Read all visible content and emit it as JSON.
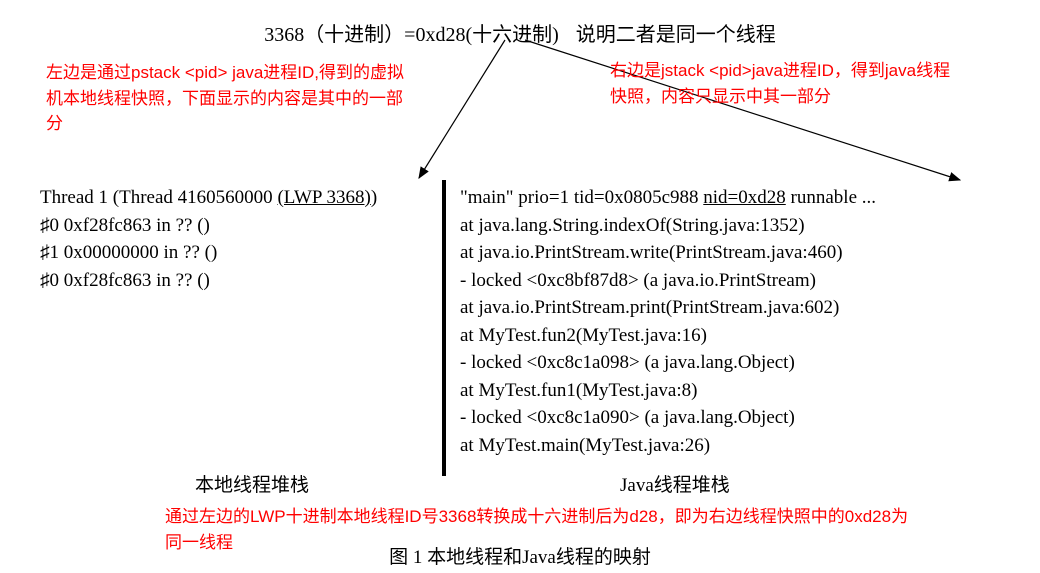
{
  "header": {
    "left": "3368（十进制）=0xd28(十六进制)",
    "right": "说明二者是同一个线程"
  },
  "annotations": {
    "left": "左边是通过pstack <pid> java进程ID,得到的虚拟机本地线程快照，下面显示的内容是其中的一部分",
    "right": "右边是jstack <pid>java进程ID，得到java线程快照，内容只显示中其一部分",
    "bottom": "通过左边的LWP十进制本地线程ID号3368转换成十六进制后为d28，即为右边线程快照中的0xd28为同一线程"
  },
  "left_stack": {
    "thread_header_prefix": "Thread 1 (Thread 4160560000 ",
    "thread_header_underline": "(LWP 3368)",
    "thread_header_suffix": ")",
    "frames": [
      "♯0 0xf28fc863 in ?? ()",
      "♯1 0x00000000 in ?? ()",
      "♯0 0xf28fc863 in ?? ()"
    ]
  },
  "right_stack": {
    "main_prefix": "\"main\" prio=1 tid=0x0805c988 ",
    "main_underline": "nid=0xd28",
    "main_suffix": " runnable ...",
    "frames": [
      "at java.lang.String.indexOf(String.java:1352)",
      "at java.io.PrintStream.write(PrintStream.java:460)",
      "- locked <0xc8bf87d8> (a java.io.PrintStream)",
      "at java.io.PrintStream.print(PrintStream.java:602)",
      "at MyTest.fun2(MyTest.java:16)",
      "- locked <0xc8c1a098> (a java.lang.Object)",
      "at MyTest.fun1(MyTest.java:8)",
      "- locked <0xc8c1a090> (a java.lang.Object)",
      "at MyTest.main(MyTest.java:26)"
    ]
  },
  "labels": {
    "left_stack": "本地线程堆栈",
    "right_stack": "Java线程堆栈"
  },
  "caption": "图 1  本地线程和Java线程的映射"
}
